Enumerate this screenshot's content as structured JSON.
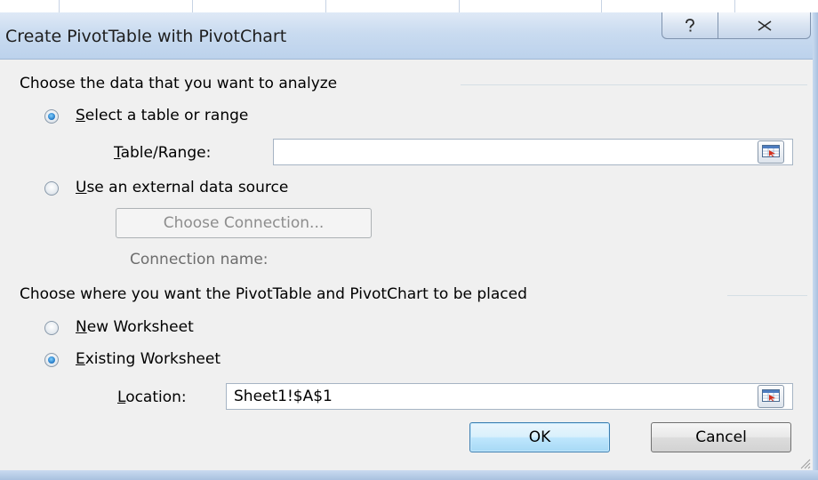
{
  "window": {
    "title": "Create PivotTable with PivotChart",
    "help_icon": "question-mark-icon",
    "close_icon": "close-x-icon"
  },
  "data_source": {
    "group_label": "Choose the data that you want to analyze",
    "select_range_radio": {
      "label_accel": "S",
      "label_rest": "elect a table or range",
      "checked": true
    },
    "table_range": {
      "label_accel": "T",
      "label_rest": "able/Range:",
      "value": "",
      "ref_icon": "collapse-dialog-icon"
    },
    "external_radio": {
      "label_accel": "U",
      "label_rest": "se an external data source",
      "checked": false
    },
    "choose_connection_button": "Choose Connection...",
    "connection_name_label": "Connection name:"
  },
  "placement": {
    "group_label": "Choose where you want the PivotTable and PivotChart to be placed",
    "new_worksheet_radio": {
      "label_accel": "N",
      "label_rest": "ew Worksheet",
      "checked": false
    },
    "existing_worksheet_radio": {
      "label_accel": "E",
      "label_rest": "xisting Worksheet",
      "checked": true
    },
    "location": {
      "label_accel": "L",
      "label_rest": "ocation:",
      "value": "Sheet1!$A$1",
      "ref_icon": "collapse-dialog-icon"
    }
  },
  "buttons": {
    "ok": "OK",
    "cancel": "Cancel"
  },
  "colors": {
    "titlebar": "#c9dbf0",
    "dialog_background": "#f0f0f0",
    "default_button_border": "#3c7fb1",
    "radio_selected": "#1f74c2"
  }
}
